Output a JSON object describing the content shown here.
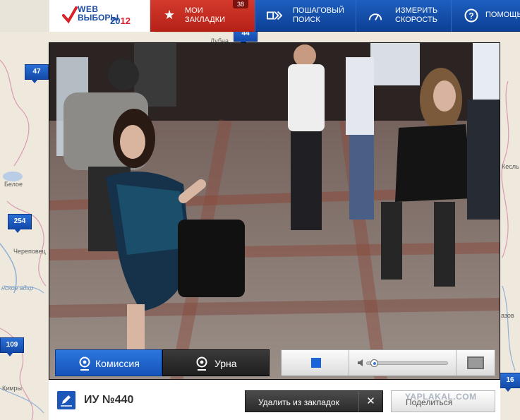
{
  "header": {
    "logo": {
      "line1": "WEB",
      "line2": "ВЫБОРЫ",
      "year_a": "20",
      "year_b": "12"
    },
    "bookmarks": {
      "line1": "МОИ",
      "line2": "ЗАКЛАДКИ",
      "count": "38"
    },
    "step_search": {
      "line1": "ПОШАГОВЫЙ",
      "line2": "ПОИСК"
    },
    "speed": {
      "line1": "ИЗМЕРИТЬ",
      "line2": "СКОРОСТЬ"
    },
    "help": {
      "label": "ПОМОЩЬ"
    }
  },
  "map": {
    "pins": [
      "44",
      "47",
      "254",
      "109",
      "16"
    ],
    "places": [
      "Череповец",
      "Кимры",
      "Белое",
      "нское вдхр",
      "Дубна",
      "Кесль",
      "азов"
    ]
  },
  "video": {
    "tabs": {
      "commission": "Комиссия",
      "urn": "Урна"
    },
    "volume_level": 0.05
  },
  "footer": {
    "station": "ИУ №440",
    "remove_bookmark": "Удалить из закладок",
    "close_symbol": "✕",
    "share": "Поделиться"
  },
  "watermark": "YAPLAKAL.COM",
  "colors": {
    "brand_blue": "#1d5fbf",
    "bookmark_red": "#c62c20",
    "dark_button": "#2b2b2b"
  }
}
